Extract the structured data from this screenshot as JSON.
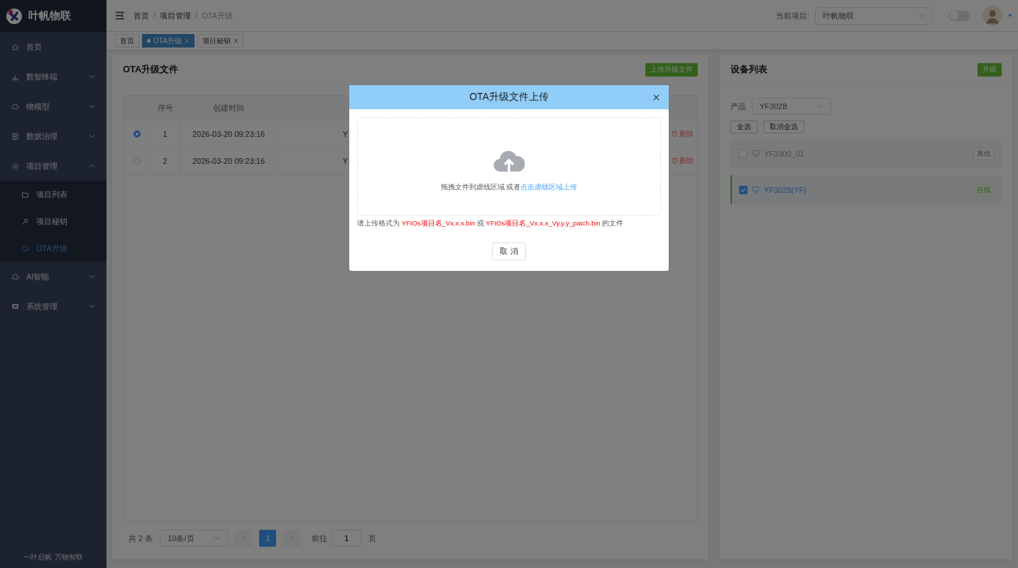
{
  "sidebar": {
    "logo": "叶帆物联",
    "items": [
      {
        "label": "首页",
        "selected": false
      },
      {
        "label": "数智终端",
        "selected": false,
        "expanded": false
      },
      {
        "label": "物模型",
        "selected": false,
        "expanded": false
      },
      {
        "label": "数据治理",
        "selected": false,
        "expanded": false
      },
      {
        "label": "项目管理",
        "selected": false,
        "expanded": true,
        "children": [
          {
            "label": "项目列表",
            "selected": false
          },
          {
            "label": "项目秘钥",
            "selected": false
          },
          {
            "label": "OTA升级",
            "selected": true
          }
        ]
      },
      {
        "label": "AI智能",
        "selected": false,
        "expanded": false
      },
      {
        "label": "系统管理",
        "selected": false,
        "expanded": false
      }
    ],
    "footer": "一叶启帆·万物智联"
  },
  "header": {
    "breadcrumb": [
      "首页",
      "项目管理",
      "OTA升级"
    ],
    "breadcrumb_separator": "/",
    "project_label": "当前项目:",
    "project": "叶帆物联",
    "toggle_on": false
  },
  "tabs": [
    {
      "label": "首页",
      "selected": false,
      "closable": false
    },
    {
      "label": "OTA升级",
      "selected": true,
      "closable": true
    },
    {
      "label": "项目秘钥",
      "selected": false,
      "closable": true
    }
  ],
  "files_panel": {
    "title": "OTA升级文件",
    "action": "上传升级文件",
    "table": {
      "columns": [
        "序号",
        "创建时间"
      ],
      "rows": [
        {
          "selected": true,
          "cells": [
            "1",
            "2026-03-20 09:23:16",
            "Y"
          ],
          "action": "删除"
        },
        {
          "selected": false,
          "cells": [
            "2",
            "2026-03-20 09:23:16",
            "Y"
          ],
          "action": "删除"
        }
      ]
    },
    "pagination": {
      "total": "共 2 条",
      "page_size": "10条/页",
      "pages": [
        {
          "label": "1",
          "selected": true
        }
      ],
      "goto_label": "前往",
      "goto_value": "1",
      "goto_suffix": "页"
    }
  },
  "devices_panel": {
    "title": "设备列表",
    "action": "升级",
    "product_label": "产品",
    "product": "YF3028",
    "select_all": "全选",
    "deselect_all": "取消全选",
    "devices": [
      {
        "name": "YF3300_01",
        "checked": false,
        "online": false,
        "status": "离线"
      },
      {
        "name": "YF3028(YF)",
        "checked": true,
        "online": true,
        "status": "在线"
      }
    ]
  },
  "dialog": {
    "title": "OTA升级文件上传",
    "drop_text": "拖拽文件到虚线区域 或者 ",
    "drop_link": "点击虚线区域上传",
    "hint": [
      {
        "text": "请上传格式为 ",
        "highlight": false
      },
      {
        "text": "YFIOs项目名_Vx.x.x.bin",
        "highlight": true
      },
      {
        "text": " 或 ",
        "highlight": false
      },
      {
        "text": "YFIOs项目名_Vx.x.x_Vy.y.y_patch.bin",
        "highlight": true
      },
      {
        "text": " 的文件",
        "highlight": false
      }
    ],
    "cancel": "取 消"
  }
}
